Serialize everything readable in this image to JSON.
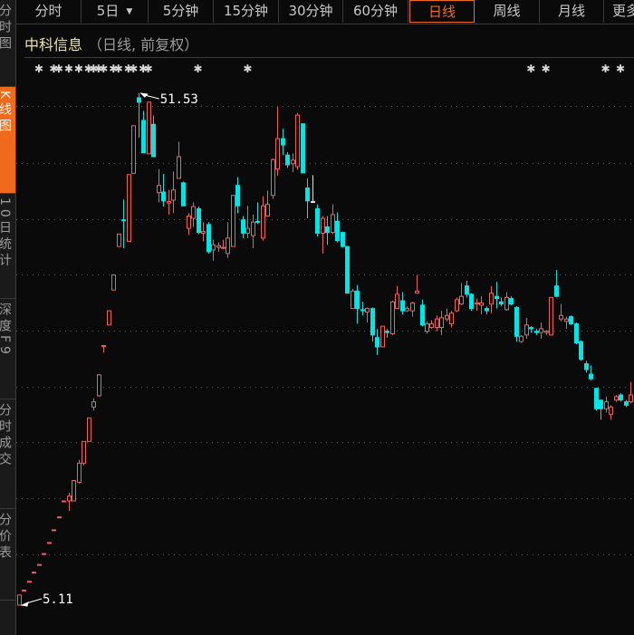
{
  "sidebar": {
    "tabs": [
      {
        "label": "分时图"
      },
      {
        "label": "K线图",
        "active": true
      },
      {
        "label": "10日统计"
      },
      {
        "label": "深度F9"
      },
      {
        "label": "分时成交"
      },
      {
        "label": "分价表"
      }
    ]
  },
  "toolbar": {
    "tabs": [
      {
        "label": "分时"
      },
      {
        "label": "5日",
        "dropdown": true
      },
      {
        "label": "5分钟"
      },
      {
        "label": "15分钟"
      },
      {
        "label": "30分钟"
      },
      {
        "label": "60分钟"
      },
      {
        "label": "日线",
        "active": true
      },
      {
        "label": "周线"
      },
      {
        "label": "月线"
      },
      {
        "label": "更多"
      }
    ]
  },
  "header": {
    "stock_name": "中科信息",
    "subtitle": "（日线, 前复权）"
  },
  "colors": {
    "up": "#f06060",
    "down": "#00e5e5",
    "flat": "#e0e0e0",
    "accent": "#f06a1e",
    "grid": "#5a5a5a"
  },
  "chart_data": {
    "type": "candlestick",
    "scale": "log",
    "ylim": [
      4.9,
      56
    ],
    "grid": true,
    "annotations": {
      "high_label": "51.53",
      "low_label": "5.11"
    },
    "event_marker_candles": [
      4,
      7,
      8,
      10,
      12,
      14,
      15,
      16,
      17,
      19,
      20,
      22,
      23,
      25,
      26,
      36,
      46,
      103,
      106,
      118,
      121
    ],
    "ohlc": [
      [
        5.11,
        5.35,
        5.11,
        5.35
      ],
      [
        5.47,
        5.47,
        5.47,
        5.47
      ],
      [
        5.69,
        5.69,
        5.69,
        5.69
      ],
      [
        5.93,
        5.93,
        5.93,
        5.93
      ],
      [
        6.14,
        6.14,
        6.14,
        6.14
      ],
      [
        6.45,
        6.45,
        6.45,
        6.45
      ],
      [
        6.78,
        6.78,
        6.78,
        6.78
      ],
      [
        7.18,
        7.18,
        7.18,
        7.18
      ],
      [
        7.61,
        7.61,
        7.61,
        7.61
      ],
      [
        8.18,
        8.18,
        8.18,
        8.18
      ],
      [
        8.18,
        8.49,
        7.82,
        8.36
      ],
      [
        8.18,
        8.97,
        8.18,
        8.97
      ],
      [
        8.9,
        9.85,
        8.85,
        9.7
      ],
      [
        9.7,
        10.7,
        9.6,
        10.7
      ],
      [
        10.7,
        11.9,
        10.7,
        11.9
      ],
      [
        12.5,
        13.0,
        12.3,
        12.8
      ],
      [
        13.15,
        14.5,
        13.1,
        14.45
      ],
      [
        16.5,
        16.5,
        16.0,
        16.5
      ],
      [
        18.1,
        19.3,
        18.1,
        19.3
      ],
      [
        21.2,
        22.7,
        21.2,
        22.7
      ],
      [
        25.8,
        27.3,
        25.8,
        27.3
      ],
      [
        29.1,
        31.9,
        25.6,
        29.0
      ],
      [
        26.4,
        35.7,
        26.4,
        35.7
      ],
      [
        35.9,
        44.5,
        35.9,
        44.5
      ],
      [
        50.5,
        51.53,
        42.2,
        49.5
      ],
      [
        45.6,
        47.6,
        39.4,
        39.4
      ],
      [
        39.2,
        49.5,
        39.2,
        49.5
      ],
      [
        44.8,
        46.6,
        38.7,
        38.7
      ],
      [
        32.9,
        36.6,
        31.5,
        34.0
      ],
      [
        33.0,
        35.8,
        30.9,
        31.7
      ],
      [
        31.4,
        33.3,
        29.8,
        31.6
      ],
      [
        31.8,
        36.2,
        30.0,
        33.3
      ],
      [
        35.1,
        41.4,
        35.1,
        38.7
      ],
      [
        34.4,
        34.6,
        31.0,
        31.0
      ],
      [
        28.0,
        30.0,
        27.2,
        29.6
      ],
      [
        29.3,
        31.5,
        28.2,
        30.9
      ],
      [
        30.6,
        30.9,
        27.3,
        27.5
      ],
      [
        27.4,
        28.8,
        26.4,
        27.6
      ],
      [
        28.5,
        28.8,
        25.0,
        25.2
      ],
      [
        25.4,
        26.6,
        24.2,
        26.0
      ],
      [
        25.7,
        26.3,
        25.2,
        25.9
      ],
      [
        25.6,
        26.6,
        25.5,
        25.7
      ],
      [
        25.0,
        28.8,
        24.5,
        26.8
      ],
      [
        25.8,
        32.6,
        25.8,
        32.5
      ],
      [
        34.0,
        35.3,
        30.0,
        31.0
      ],
      [
        29.1,
        29.6,
        26.8,
        27.4
      ],
      [
        27.4,
        31.0,
        26.8,
        28.0
      ],
      [
        27.1,
        29.8,
        25.6,
        28.8
      ],
      [
        28.9,
        31.5,
        28.6,
        28.8
      ],
      [
        26.8,
        32.4,
        26.5,
        31.0
      ],
      [
        29.6,
        33.2,
        29.6,
        31.2
      ],
      [
        32.5,
        38.4,
        32.0,
        38.2
      ],
      [
        36.6,
        48.5,
        35.5,
        42.0
      ],
      [
        42.0,
        43.9,
        39.0,
        40.8
      ],
      [
        39.0,
        39.5,
        36.8,
        37.3
      ],
      [
        37.5,
        39.3,
        36.1,
        38.1
      ],
      [
        37.0,
        47.2,
        36.5,
        46.7
      ],
      [
        44.9,
        45.0,
        36.0,
        36.0
      ],
      [
        33.6,
        35.1,
        29.3,
        31.7
      ],
      [
        31.6,
        35.6,
        31.6,
        31.6
      ],
      [
        30.6,
        31.2,
        27.0,
        27.4
      ],
      [
        27.4,
        29.6,
        25.0,
        29.3
      ],
      [
        28.2,
        29.6,
        26.0,
        27.5
      ],
      [
        27.5,
        31.2,
        27.3,
        29.8
      ],
      [
        28.9,
        30.1,
        26.3,
        26.5
      ],
      [
        27.5,
        27.6,
        25.7,
        25.8
      ],
      [
        25.8,
        25.9,
        20.9,
        20.9
      ],
      [
        19.5,
        21.3,
        19.5,
        21.1
      ],
      [
        21.1,
        21.7,
        18.2,
        19.5
      ],
      [
        19.4,
        20.1,
        18.9,
        19.3
      ],
      [
        19.2,
        19.6,
        18.3,
        19.5
      ],
      [
        19.5,
        19.6,
        16.8,
        17.3
      ],
      [
        17.1,
        17.8,
        15.8,
        16.4
      ],
      [
        16.4,
        18.0,
        16.4,
        18.0
      ],
      [
        17.6,
        17.8,
        17.1,
        17.5
      ],
      [
        17.4,
        20.2,
        17.3,
        20.1
      ],
      [
        19.5,
        21.6,
        19.5,
        20.8
      ],
      [
        20.2,
        21.0,
        19.0,
        19.3
      ],
      [
        19.3,
        19.7,
        19.2,
        19.5
      ],
      [
        19.3,
        20.1,
        18.8,
        20.0
      ],
      [
        20.9,
        22.7,
        20.9,
        21.1
      ],
      [
        19.8,
        20.3,
        18.0,
        18.1
      ],
      [
        17.6,
        18.4,
        17.4,
        18.2
      ],
      [
        17.9,
        18.5,
        17.8,
        18.2
      ],
      [
        17.9,
        18.9,
        17.6,
        18.6
      ],
      [
        17.9,
        19.3,
        17.3,
        18.7
      ],
      [
        18.6,
        19.5,
        18.4,
        18.9
      ],
      [
        18.2,
        19.3,
        17.9,
        19.1
      ],
      [
        19.3,
        20.5,
        19.2,
        20.3
      ],
      [
        19.9,
        21.9,
        19.8,
        20.6
      ],
      [
        21.6,
        22.1,
        20.5,
        20.8
      ],
      [
        20.8,
        20.9,
        19.3,
        19.5
      ],
      [
        19.9,
        20.4,
        19.3,
        20.0
      ],
      [
        19.8,
        20.6,
        19.0,
        20.0
      ],
      [
        19.5,
        19.7,
        19.0,
        19.3
      ],
      [
        19.9,
        21.6,
        19.1,
        20.9
      ],
      [
        20.6,
        22.0,
        19.5,
        20.4
      ],
      [
        20.1,
        20.5,
        19.7,
        19.9
      ],
      [
        19.4,
        21.0,
        19.3,
        20.5
      ],
      [
        20.4,
        20.6,
        19.8,
        19.9
      ],
      [
        19.6,
        19.7,
        16.8,
        17.2
      ],
      [
        16.8,
        17.3,
        16.7,
        17.2
      ],
      [
        17.3,
        18.7,
        17.0,
        18.1
      ],
      [
        17.9,
        18.0,
        17.5,
        17.8
      ],
      [
        17.6,
        17.8,
        17.3,
        17.5
      ],
      [
        17.5,
        18.3,
        17.0,
        17.8
      ],
      [
        17.5,
        17.7,
        17.3,
        17.6
      ],
      [
        17.3,
        20.5,
        17.3,
        20.5
      ],
      [
        21.6,
        23.2,
        20.5,
        20.6
      ],
      [
        18.6,
        19.9,
        18.4,
        18.9
      ],
      [
        18.4,
        18.8,
        17.8,
        18.6
      ],
      [
        18.8,
        18.9,
        18.1,
        18.2
      ],
      [
        18.2,
        18.3,
        16.6,
        16.7
      ],
      [
        16.8,
        16.9,
        15.4,
        15.5
      ],
      [
        15.2,
        15.4,
        14.6,
        14.8
      ],
      [
        14.5,
        15.1,
        14.1,
        14.2
      ],
      [
        13.6,
        13.6,
        12.3,
        12.4
      ],
      [
        12.9,
        12.9,
        11.8,
        12.4
      ],
      [
        12.4,
        13.1,
        12.2,
        12.8
      ],
      [
        12.1,
        12.6,
        11.8,
        12.5
      ],
      [
        12.9,
        13.2,
        12.8,
        13.1
      ],
      [
        13.2,
        13.3,
        12.8,
        12.9
      ],
      [
        12.8,
        12.9,
        12.5,
        12.6
      ],
      [
        12.8,
        14.0,
        12.7,
        13.2
      ]
    ]
  }
}
